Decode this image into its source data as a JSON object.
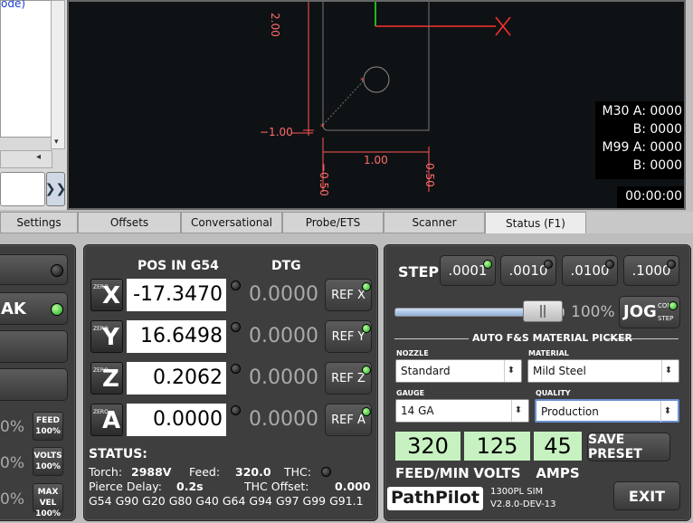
{
  "left_panel": {
    "list_fragment": "ode)",
    "send_icon": "double-chevron-right-icon"
  },
  "plot": {
    "label_200": "2.00",
    "label_neg100": "−1.00",
    "label_100": "1.00",
    "label_neg050": "−0.50",
    "label_050": "0.50",
    "m30a": "M30 A: 0000",
    "m30b": "B: 0000",
    "m99a": "M99 A: 0000",
    "m99b": "B: 0000",
    "timer": "00:00:00",
    "colors": {
      "bg": "#0f1214",
      "dim": "#ff5555",
      "x_axis": "#ff3030",
      "y_axis": "#22ee22"
    }
  },
  "tabs": [
    {
      "label": "Settings"
    },
    {
      "label": "Offsets"
    },
    {
      "label": "Conversational"
    },
    {
      "label": "Probe/ETS"
    },
    {
      "label": "Scanner"
    },
    {
      "label": "Status (F1)"
    }
  ],
  "left_controls": {
    "ak_label": "AK",
    "feed_pct": "0%",
    "volts_pct": "0%",
    "maxvel_pct": "0%",
    "feed_btn": [
      "FEED",
      "100%"
    ],
    "volts_btn": [
      "VOLTS",
      "100%"
    ],
    "maxvel_btn": [
      "MAX VEL",
      "100%"
    ]
  },
  "dro": {
    "header_pos": "POS IN G54",
    "header_dtg": "DTG",
    "zero_text": "ZERO",
    "axes": [
      {
        "letter": "X",
        "pos": "-17.3470",
        "dtg": "0.0000",
        "ref": "REF X"
      },
      {
        "letter": "Y",
        "pos": "16.6498",
        "dtg": "0.0000",
        "ref": "REF Y"
      },
      {
        "letter": "Z",
        "pos": "0.2062",
        "dtg": "0.0000",
        "ref": "REF Z"
      },
      {
        "letter": "A",
        "pos": "0.0000",
        "dtg": "0.0000",
        "ref": "REF A"
      }
    ],
    "status_title": "STATUS:",
    "torch_label": "Torch:",
    "torch_val": "2988V",
    "feed_label": "Feed:",
    "feed_val": "320.0",
    "thc_label": "THC:",
    "pierce_label": "Pierce Delay:",
    "pierce_val": "0.2s",
    "thc_offset_label": "THC Offset:",
    "thc_offset_val": "0.000",
    "gcodes": "G54 G90 G20 G80 G40 G64 G94 G97 G99 G91.1"
  },
  "right_panel": {
    "step_label": "STEP:",
    "steps": [
      ".0001",
      ".0010",
      ".0100",
      ".1000"
    ],
    "jog_pct": "100%",
    "jog_label": "JOG",
    "jog_cont": "CONT",
    "jog_step": "STEP",
    "jog_level": 1.0,
    "picker_title": "AUTO F&S MATERIAL PICKER",
    "nozzle_label": "NOZZLE",
    "nozzle_val": "Standard",
    "material_label": "MATERIAL",
    "material_val": "Mild Steel",
    "gauge_label": "GAUGE",
    "gauge_val": "14 GA",
    "quality_label": "QUALITY",
    "quality_val": "Production",
    "feed_val": "320",
    "volts_val": "125",
    "amps_val": "45",
    "feed_unit": "FEED/MIN",
    "volts_unit": "VOLTS",
    "amps_unit": "AMPS",
    "save_preset": "SAVE PRESET",
    "logo": "PathPilot",
    "machine": "1300PL SIM",
    "version": "V2.8.0-DEV-13",
    "exit": "EXIT"
  }
}
